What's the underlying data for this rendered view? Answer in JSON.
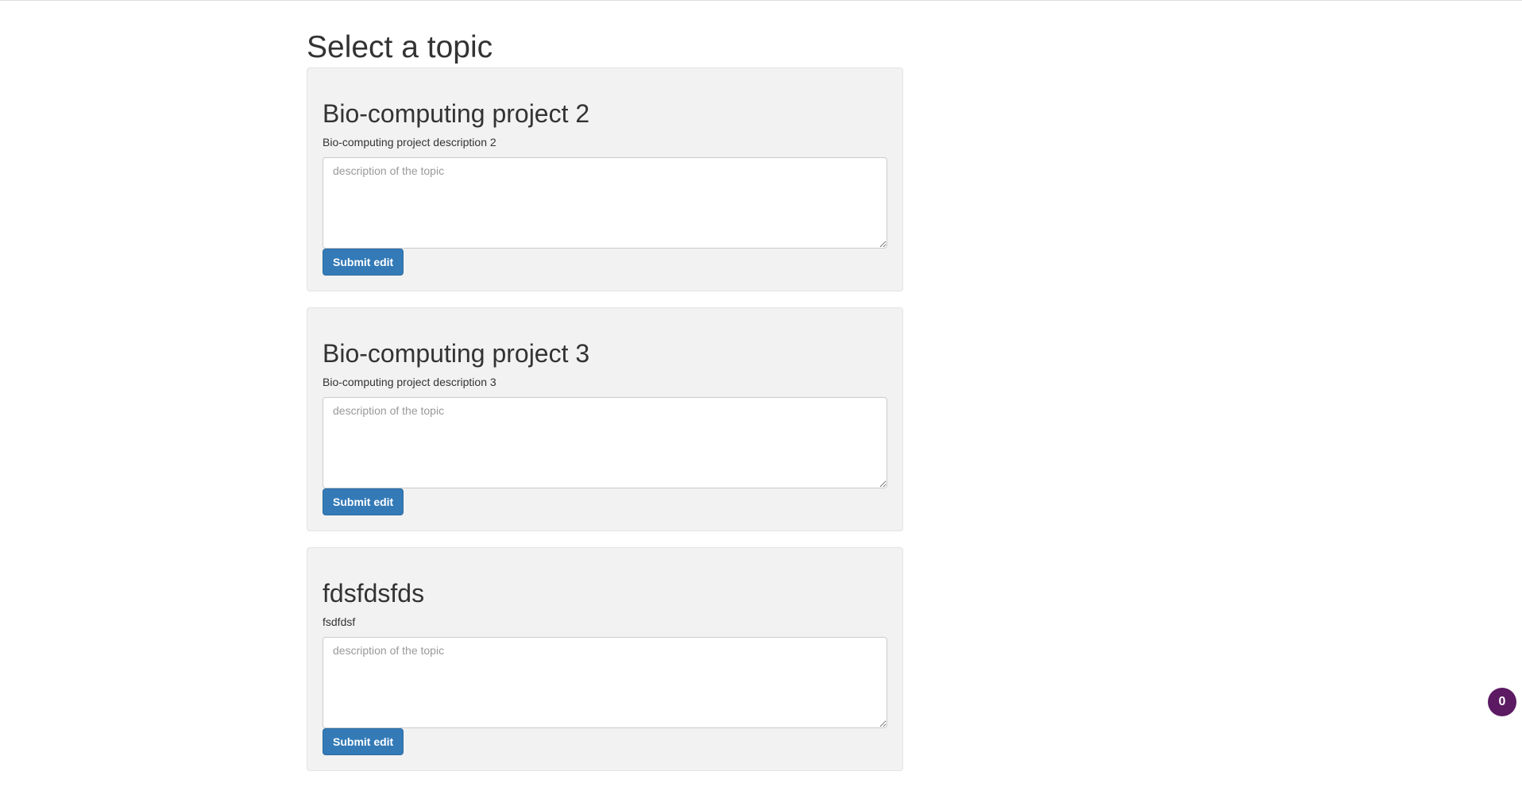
{
  "page": {
    "title": "Select a topic"
  },
  "topics": [
    {
      "title": "Bio-computing project 2",
      "description": "Bio-computing project description 2",
      "textarea_placeholder": "description of the topic",
      "submit_label": "Submit edit"
    },
    {
      "title": "Bio-computing project 3",
      "description": "Bio-computing project description 3",
      "textarea_placeholder": "description of the topic",
      "submit_label": "Submit edit"
    },
    {
      "title": "fdsfdsfds",
      "description": "fsdfdsf",
      "textarea_placeholder": "description of the topic",
      "submit_label": "Submit edit"
    }
  ],
  "badge": {
    "count": "0"
  },
  "colors": {
    "primary_button": "#337ab7",
    "card_background": "#f2f2f2",
    "badge_background": "#5c1a63"
  }
}
